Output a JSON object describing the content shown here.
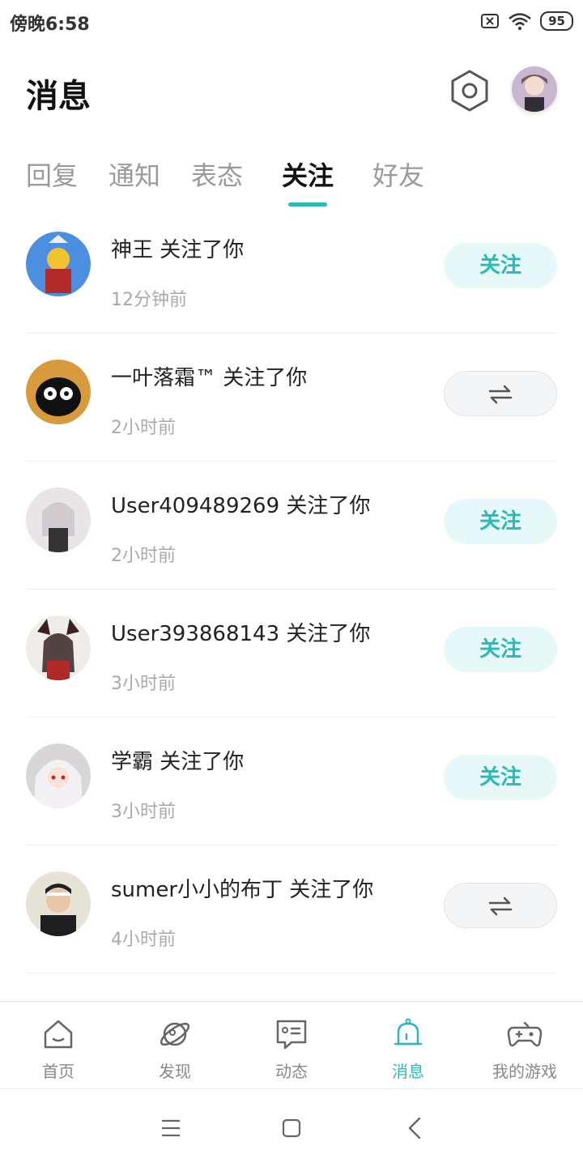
{
  "status": {
    "time": "傍晚6:58",
    "battery": "95"
  },
  "header": {
    "title": "消息"
  },
  "tabs": [
    {
      "label": "回复"
    },
    {
      "label": "通知"
    },
    {
      "label": "表态"
    },
    {
      "label": "关注"
    },
    {
      "label": "好友"
    }
  ],
  "active_tab": "关注",
  "follow_label": "关注",
  "mutual_symbol": "⇌",
  "rows": [
    {
      "name": "神王 关注了你",
      "time": "12分钟前",
      "button": "follow"
    },
    {
      "name": "一叶落霜™ 关注了你",
      "time": "2小时前",
      "button": "mutual"
    },
    {
      "name": "User409489269 关注了你",
      "time": "2小时前",
      "button": "follow"
    },
    {
      "name": "User393868143 关注了你",
      "time": "3小时前",
      "button": "follow"
    },
    {
      "name": "学霸 关注了你",
      "time": "3小时前",
      "button": "follow"
    },
    {
      "name": "sumer小小的布丁 关注了你",
      "time": "4小时前",
      "button": "mutual"
    }
  ],
  "nav": [
    {
      "label": "首页",
      "icon": "home-icon"
    },
    {
      "label": "发现",
      "icon": "planet-icon"
    },
    {
      "label": "动态",
      "icon": "feed-icon"
    },
    {
      "label": "消息",
      "icon": "bell-icon"
    },
    {
      "label": "我的游戏",
      "icon": "gamepad-icon"
    }
  ],
  "colors": {
    "accent": "#2cb8b8",
    "follow_bg": "#e6f8f8",
    "muted": "#aaaaaa"
  }
}
